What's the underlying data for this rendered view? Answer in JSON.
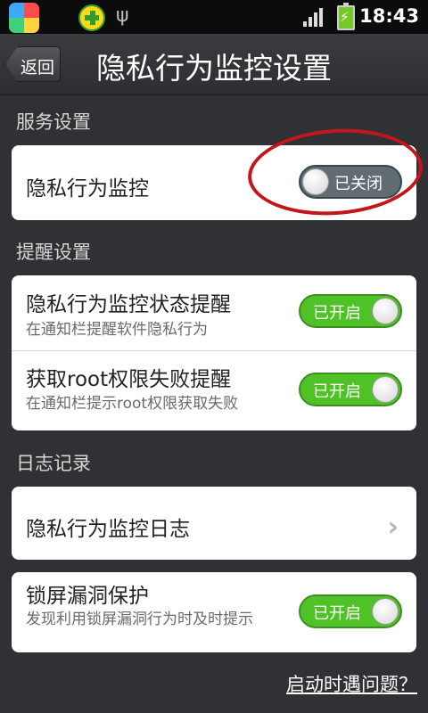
{
  "status_bar": {
    "icons": [
      "app-launcher-icon",
      "security-app-icon",
      "usb-icon",
      "signal-icon",
      "battery-charging-icon"
    ],
    "time": "18:43"
  },
  "title_bar": {
    "back_label": "返回",
    "title": "隐私行为监控设置"
  },
  "sections": {
    "service": {
      "header": "服务设置",
      "items": [
        {
          "title": "隐私行为监控",
          "toggle_label": "已关闭",
          "enabled": false
        }
      ]
    },
    "reminder": {
      "header": "提醒设置",
      "items": [
        {
          "title": "隐私行为监控状态提醒",
          "subtitle": "在通知栏提醒软件隐私行为",
          "toggle_label": "已开启",
          "enabled": true
        },
        {
          "title": "获取root权限失败提醒",
          "subtitle": "在通知栏提示root权限获取失败",
          "toggle_label": "已开启",
          "enabled": true
        }
      ]
    },
    "log": {
      "header": "日志记录",
      "items": [
        {
          "title": "隐私行为监控日志",
          "icon": "chevron-right-icon"
        }
      ]
    },
    "lockscreen": {
      "items": [
        {
          "title": "锁屏漏洞保护",
          "subtitle": "发现利用锁屏漏洞行为时及时提示",
          "toggle_label": "已开启",
          "enabled": true
        }
      ]
    }
  },
  "footer": {
    "link_label": "启动时遇问题？"
  },
  "colors": {
    "toggle_on": "#4fc227",
    "toggle_off": "#5f6d73",
    "highlight_circle": "#c3161c"
  }
}
